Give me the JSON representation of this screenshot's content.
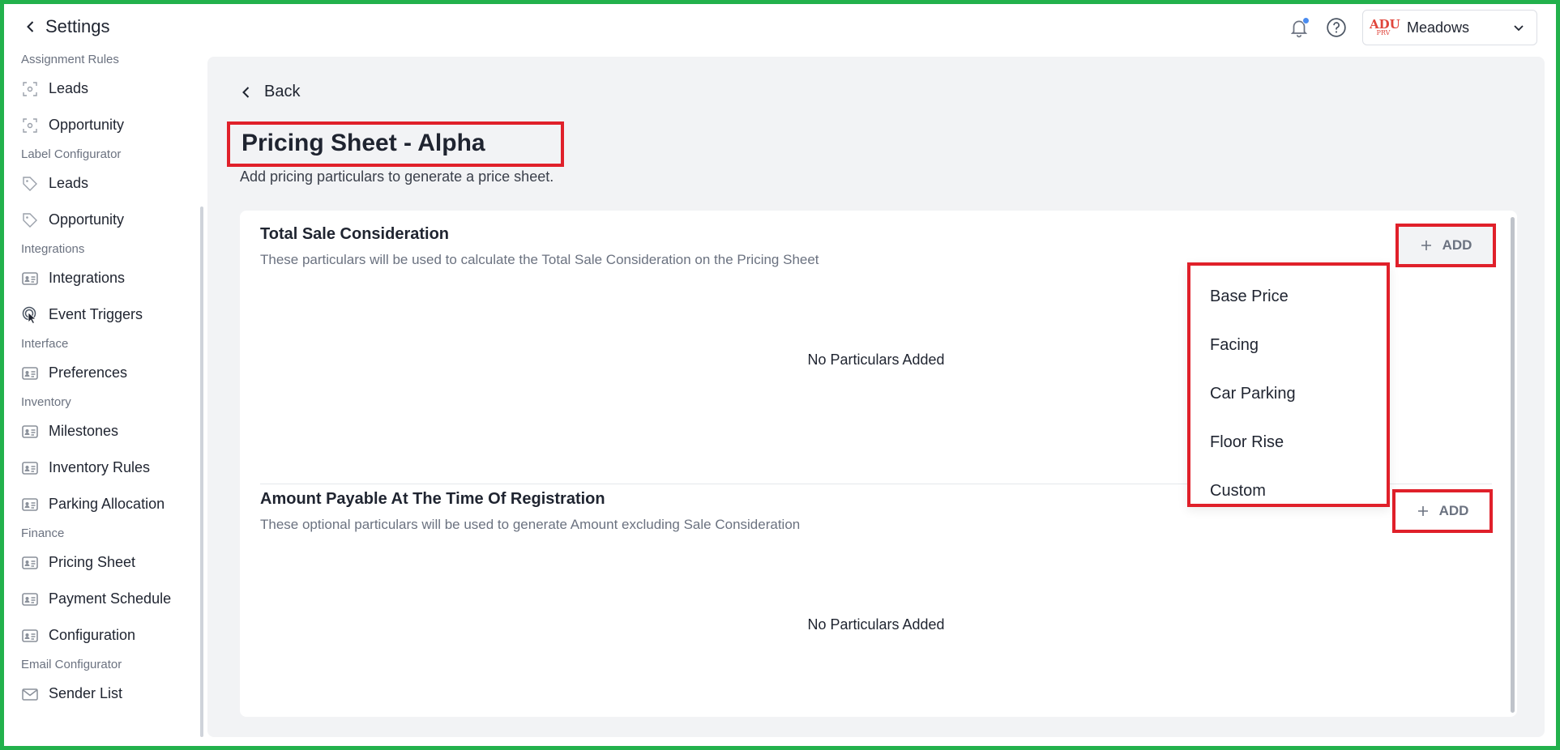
{
  "header": {
    "back_label": "Settings",
    "account_name": "Meadows",
    "logo_text": "ADU",
    "logo_sub": "PRV"
  },
  "sidebar": {
    "groups": [
      {
        "section": "Assignment Rules",
        "items": [
          {
            "label": "Leads",
            "icon": "target-icon"
          },
          {
            "label": "Opportunity",
            "icon": "target-icon"
          }
        ]
      },
      {
        "section": "Label Configurator",
        "items": [
          {
            "label": "Leads",
            "icon": "tag-icon"
          },
          {
            "label": "Opportunity",
            "icon": "tag-icon"
          }
        ]
      },
      {
        "section": "Integrations",
        "items": [
          {
            "label": "Integrations",
            "icon": "id-card-icon"
          },
          {
            "label": "Event Triggers",
            "icon": "tap-icon"
          }
        ]
      },
      {
        "section": "Interface",
        "items": [
          {
            "label": "Preferences",
            "icon": "id-card-icon"
          }
        ]
      },
      {
        "section": "Inventory",
        "items": [
          {
            "label": "Milestones",
            "icon": "id-card-icon"
          },
          {
            "label": "Inventory Rules",
            "icon": "id-card-icon"
          },
          {
            "label": "Parking Allocation",
            "icon": "id-card-icon"
          }
        ]
      },
      {
        "section": "Finance",
        "items": [
          {
            "label": "Pricing Sheet",
            "icon": "id-card-icon"
          },
          {
            "label": "Payment Schedule",
            "icon": "id-card-icon"
          },
          {
            "label": "Configuration",
            "icon": "id-card-icon"
          }
        ]
      },
      {
        "section": "Email Configurator",
        "items": [
          {
            "label": "Sender List",
            "icon": "mail-icon"
          }
        ]
      }
    ]
  },
  "main": {
    "back_label": "Back",
    "title": "Pricing Sheet - Alpha",
    "subtitle": "Add pricing particulars to generate a price sheet.",
    "sections": [
      {
        "title": "Total Sale Consideration",
        "description": "These particulars will be used to calculate the Total Sale Consideration on the Pricing Sheet",
        "empty_text": "No Particulars Added",
        "add_label": "ADD"
      },
      {
        "title": "Amount Payable At The Time Of Registration",
        "description": "These optional particulars will be used to generate Amount excluding Sale Consideration",
        "empty_text": "No Particulars Added",
        "add_label": "ADD"
      }
    ],
    "dropdown_options": [
      "Base Price",
      "Facing",
      "Car Parking",
      "Floor Rise",
      "Custom"
    ]
  },
  "colors": {
    "highlight": "#e0202a",
    "frame": "#22b14c",
    "notification_dot": "#4a8cf0",
    "main_bg": "#f2f3f5"
  }
}
